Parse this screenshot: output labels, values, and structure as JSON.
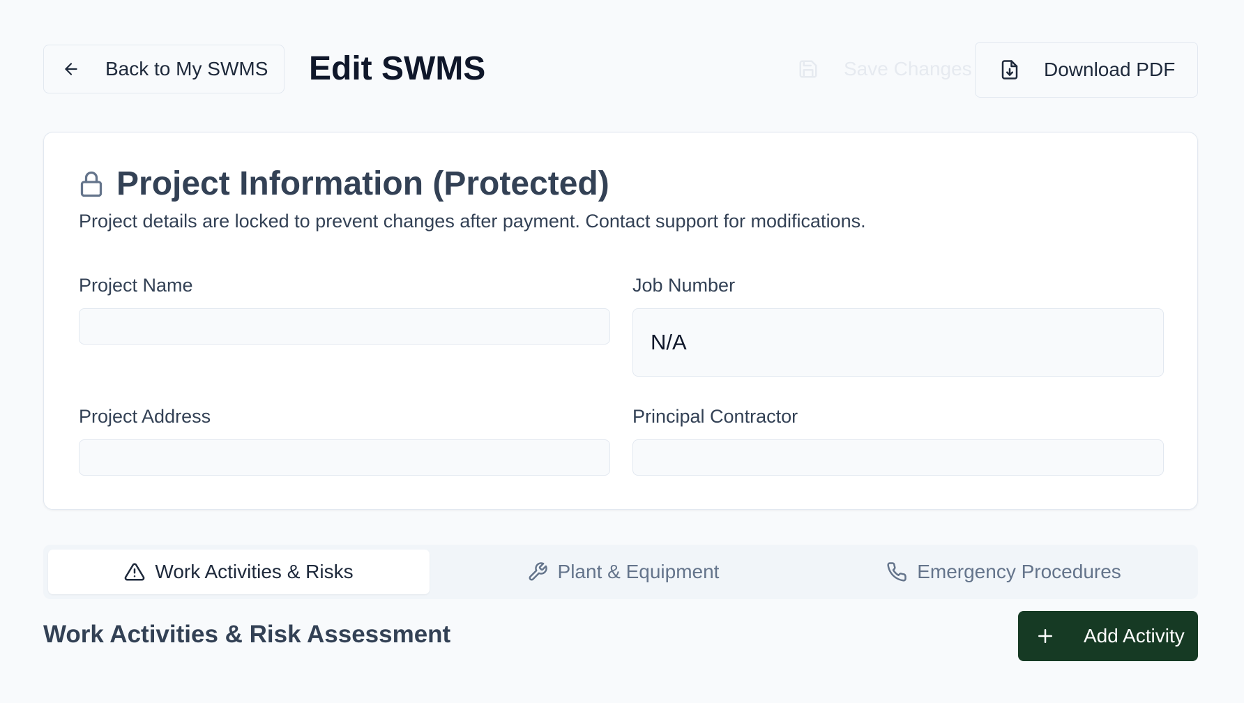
{
  "header": {
    "back_label": "Back to My SWMS",
    "title": "Edit SWMS",
    "save_label": "Save Changes",
    "download_label": "Download PDF"
  },
  "project_info": {
    "title": "Project Information (Protected)",
    "description": "Project details are locked to prevent changes after payment. Contact support for modifications.",
    "fields": {
      "project_name": {
        "label": "Project Name",
        "value": ""
      },
      "job_number": {
        "label": "Job Number",
        "value": "N/A"
      },
      "project_address": {
        "label": "Project Address",
        "value": ""
      },
      "principal_contractor": {
        "label": "Principal Contractor",
        "value": ""
      }
    }
  },
  "tabs": [
    {
      "label": "Work Activities & Risks",
      "icon": "warning-triangle-icon",
      "active": true
    },
    {
      "label": "Plant & Equipment",
      "icon": "wrench-icon",
      "active": false
    },
    {
      "label": "Emergency Procedures",
      "icon": "phone-icon",
      "active": false
    }
  ],
  "section": {
    "title": "Work Activities & Risk Assessment",
    "add_label": "Add Activity"
  },
  "colors": {
    "background": "#f8fafc",
    "card": "#ffffff",
    "border": "#e2e8f0",
    "heading": "#334155",
    "primary_button": "#163a24",
    "tab_track": "#f1f5f9"
  }
}
